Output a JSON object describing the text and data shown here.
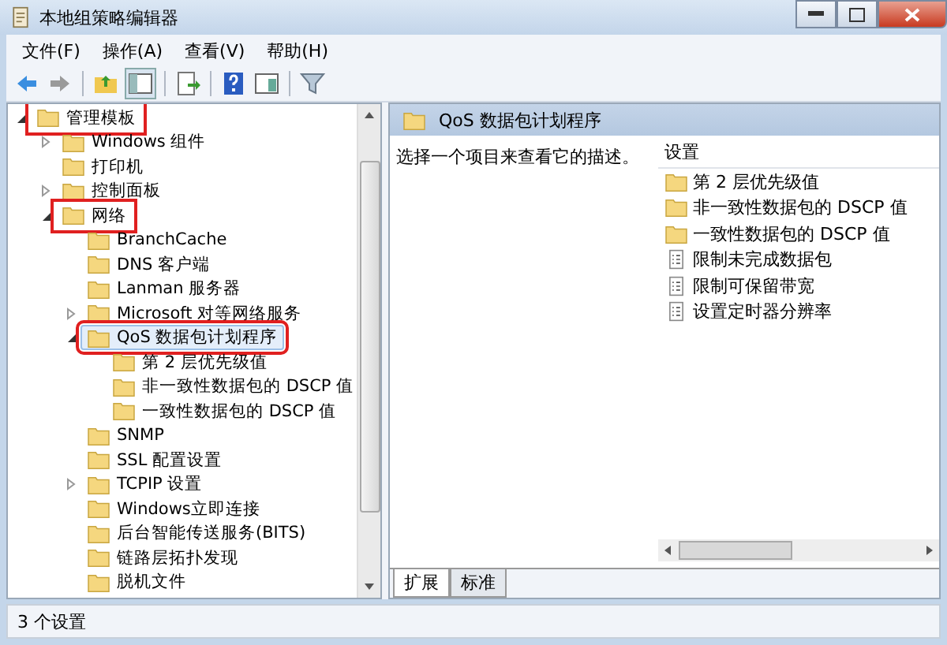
{
  "window": {
    "title": "本地组策略编辑器"
  },
  "menu": [
    "文件(F)",
    "操作(A)",
    "查看(V)",
    "帮助(H)"
  ],
  "tree": [
    {
      "label": "管理模板",
      "expanded": true,
      "selected": false,
      "highlighted": true,
      "children": [
        {
          "label": "Windows 组件",
          "expanded": false,
          "selected": false,
          "highlighted": false
        },
        {
          "label": "打印机",
          "selected": false,
          "highlighted": false
        },
        {
          "label": "控制面板",
          "expanded": false,
          "selected": false,
          "highlighted": false
        },
        {
          "label": "网络",
          "expanded": true,
          "selected": false,
          "highlighted": true,
          "children": [
            {
              "label": "BranchCache",
              "selected": false,
              "highlighted": false
            },
            {
              "label": "DNS 客户端",
              "selected": false,
              "highlighted": false
            },
            {
              "label": "Lanman 服务器",
              "selected": false,
              "highlighted": false
            },
            {
              "label": "Microsoft 对等网络服务",
              "expanded": false,
              "selected": false,
              "highlighted": false
            },
            {
              "label": "QoS 数据包计划程序",
              "expanded": true,
              "selected": true,
              "highlighted": true,
              "children": [
                {
                  "label": "第 2 层优先级值",
                  "selected": false,
                  "highlighted": false
                },
                {
                  "label": "非一致性数据包的 DSCP 值",
                  "selected": false,
                  "highlighted": false
                },
                {
                  "label": "一致性数据包的 DSCP 值",
                  "selected": false,
                  "highlighted": false
                }
              ]
            },
            {
              "label": "SNMP",
              "selected": false,
              "highlighted": false
            },
            {
              "label": "SSL 配置设置",
              "selected": false,
              "highlighted": false
            },
            {
              "label": "TCPIP 设置",
              "expanded": false,
              "selected": false,
              "highlighted": false
            },
            {
              "label": "Windows立即连接",
              "selected": false,
              "highlighted": false
            },
            {
              "label": "后台智能传送服务(BITS)",
              "selected": false,
              "highlighted": false
            },
            {
              "label": "链路层拓扑发现",
              "selected": false,
              "highlighted": false
            },
            {
              "label": "脱机文件",
              "selected": false,
              "highlighted": false
            }
          ]
        }
      ]
    }
  ],
  "detail": {
    "title": "QoS 数据包计划程序",
    "description": "选择一个项目来查看它的描述。",
    "column": "设置",
    "items": [
      {
        "kind": "folder",
        "label": "第 2 层优先级值"
      },
      {
        "kind": "folder",
        "label": "非一致性数据包的 DSCP 值"
      },
      {
        "kind": "folder",
        "label": "一致性数据包的 DSCP 值"
      },
      {
        "kind": "setting",
        "label": "限制未完成数据包"
      },
      {
        "kind": "setting",
        "label": "限制可保留带宽"
      },
      {
        "kind": "setting",
        "label": "设置定时器分辨率"
      }
    ],
    "tabs": [
      {
        "label": "扩展",
        "selected": true
      },
      {
        "label": "标准",
        "selected": false
      }
    ]
  },
  "status_bar": "3 个设置"
}
